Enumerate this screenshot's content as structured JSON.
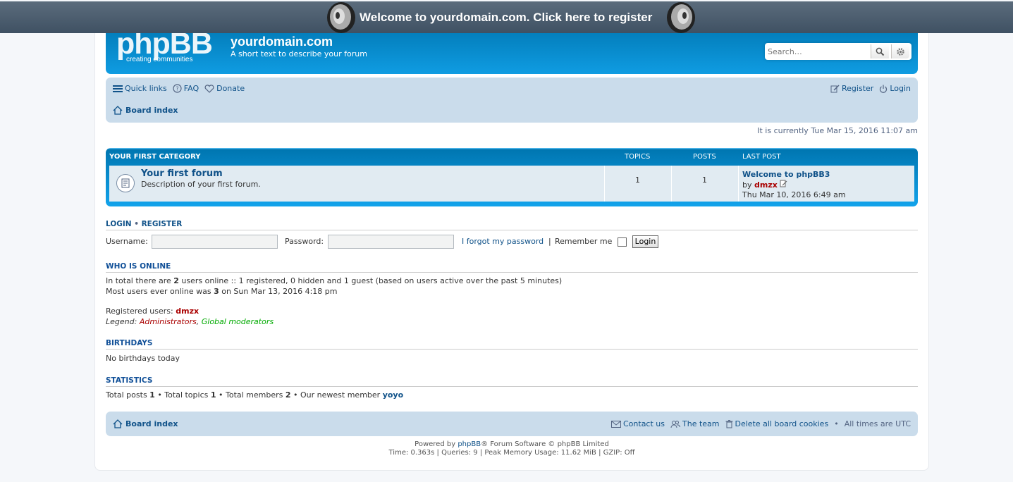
{
  "banner": {
    "text": "Welcome to yourdomain.com. Click here to register"
  },
  "header": {
    "logo_text": "phpBB",
    "logo_sub": "creating communities",
    "site_title": "yourdomain.com",
    "site_desc": "A short text to describe your forum",
    "search_placeholder": "Search…"
  },
  "navbar": {
    "quick_links": "Quick links",
    "faq": "FAQ",
    "donate": "Donate",
    "register": "Register",
    "login": "Login",
    "breadcrumb": "Board index"
  },
  "current_time": "It is currently Tue Mar 15, 2016 11:07 am",
  "category": {
    "name": "YOUR FIRST CATEGORY",
    "col_topics": "TOPICS",
    "col_posts": "POSTS",
    "col_lastpost": "LAST POST",
    "forum": {
      "name": "Your first forum",
      "desc": "Description of your first forum.",
      "topics": "1",
      "posts": "1",
      "last_post_title": "Welcome to phpBB3",
      "by": "by",
      "last_post_user": "dmzx",
      "last_post_time": "Thu Mar 10, 2016 6:49 am"
    }
  },
  "login": {
    "title_login": "LOGIN",
    "sep": "•",
    "title_register": "REGISTER",
    "username_label": "Username:",
    "password_label": "Password:",
    "forgot": "I forgot my password",
    "pipe": "|",
    "remember": "Remember me",
    "button": "Login"
  },
  "online": {
    "title": "WHO IS ONLINE",
    "line1_a": "In total there are ",
    "line1_count": "2",
    "line1_b": " users online :: 1 registered, 0 hidden and 1 guest (based on users active over the past 5 minutes)",
    "line2_a": "Most users ever online was ",
    "line2_count": "3",
    "line2_b": " on Sun Mar 13, 2016 4:18 pm",
    "registered_label": "Registered users: ",
    "registered_user": "dmzx",
    "legend_label": "Legend: ",
    "legend_admin": "Administrators",
    "legend_comma": ", ",
    "legend_mod": "Global moderators"
  },
  "birthdays": {
    "title": "BIRTHDAYS",
    "text": "No birthdays today"
  },
  "stats": {
    "title": "STATISTICS",
    "a": "Total posts ",
    "posts": "1",
    "b": " • Total topics ",
    "topics": "1",
    "c": " • Total members ",
    "members": "2",
    "d": " • Our newest member ",
    "newest": "yoyo"
  },
  "footer": {
    "breadcrumb": "Board index",
    "contact": "Contact us",
    "team": "The team",
    "delete_cookies": "Delete all board cookies",
    "bullet": "•",
    "timezone": "All times are UTC",
    "powered_a": "Powered by ",
    "powered_link": "phpBB",
    "powered_b": "® Forum Software © phpBB Limited",
    "stats_line": "Time: 0.363s | Queries: 9 | Peak Memory Usage: 11.62 MiB | GZIP: Off"
  },
  "colors": {
    "admin": "#aa0000",
    "mod": "#00aa00",
    "header_blue": "#12a3eb",
    "nav_bg": "#cadceb"
  }
}
